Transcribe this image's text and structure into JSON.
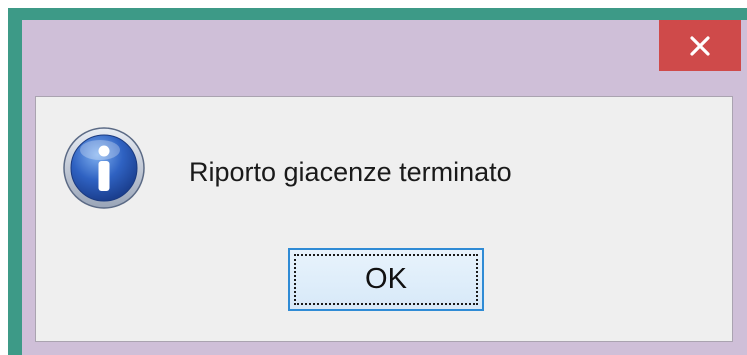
{
  "dialog": {
    "message": "Riporto giacenze terminato",
    "ok_label": "OK",
    "close_label": "✕",
    "icon": "info-icon"
  },
  "colors": {
    "window_border": "#3d9a87",
    "titlebar": "#cfbfd8",
    "close_button": "#cf4a4a",
    "client_background": "#efefef",
    "button_border": "#2f8bd5"
  }
}
